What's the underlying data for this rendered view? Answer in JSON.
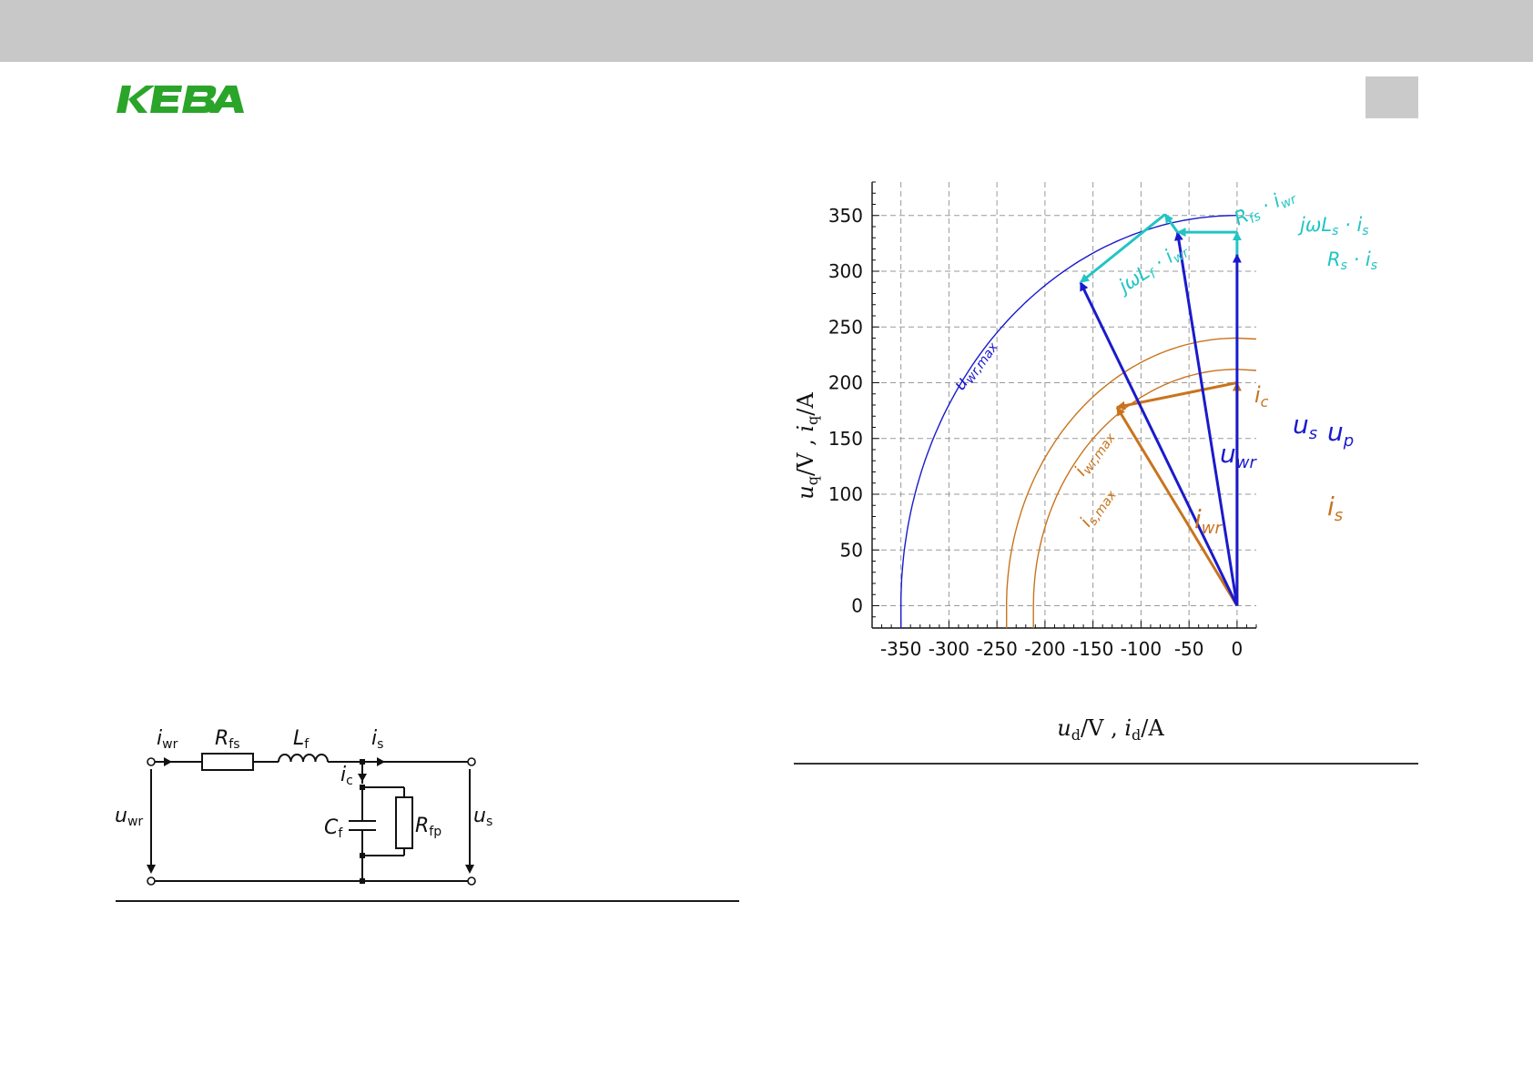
{
  "logo": {
    "text": "KEBA",
    "color": "#2aa52a"
  },
  "circuit": {
    "labels": {
      "i_wr": "i",
      "i_wr_sub": "wr",
      "R_fs": "R",
      "R_fs_sub": "fs",
      "L_f": "L",
      "L_f_sub": "f",
      "i_s": "i",
      "i_s_sub": "s",
      "i_c": "i",
      "i_c_sub": "c",
      "C_f": "C",
      "C_f_sub": "f",
      "R_fp": "R",
      "R_fp_sub": "fp",
      "u_wr": "u",
      "u_wr_sub": "wr",
      "u_s": "u",
      "u_s_sub": "s"
    }
  },
  "chart_data": {
    "type": "phasor-diagram",
    "xlabel": "ud/V , id/A",
    "ylabel": "uq/V , iq/A",
    "xlim": [
      -380,
      20
    ],
    "ylim": [
      -20,
      380
    ],
    "xticks": [
      -350,
      -300,
      -250,
      -200,
      -150,
      -100,
      -50,
      0
    ],
    "yticks": [
      0,
      50,
      100,
      150,
      200,
      250,
      300,
      350
    ],
    "grid": true,
    "colors": {
      "voltage": "#1a1acc",
      "current": "#c8741e",
      "drop": "#22c4c4"
    },
    "circles": [
      {
        "name": "uwr,max",
        "radius": 350,
        "color": "#1a1acc"
      },
      {
        "name": "iwr,max",
        "radius": 240,
        "color": "#c8741e"
      },
      {
        "name": "is,max",
        "radius": 212,
        "color": "#c8741e"
      }
    ],
    "vectors": [
      {
        "name": "is",
        "from": [
          0,
          0
        ],
        "to": [
          0,
          200
        ],
        "color": "#c8741e"
      },
      {
        "name": "iwr",
        "from": [
          0,
          0
        ],
        "to": [
          -125,
          178
        ],
        "color": "#c8741e"
      },
      {
        "name": "ic",
        "from": [
          0,
          200
        ],
        "to": [
          -125,
          178
        ],
        "color": "#c8741e"
      },
      {
        "name": "up",
        "from": [
          0,
          0
        ],
        "to": [
          0,
          315
        ],
        "color": "#1a1acc"
      },
      {
        "name": "us",
        "from": [
          0,
          0
        ],
        "to": [
          -62,
          335
        ],
        "color": "#1a1acc"
      },
      {
        "name": "uwr",
        "from": [
          0,
          0
        ],
        "to": [
          -163,
          290
        ],
        "color": "#1a1acc"
      },
      {
        "name": "Rs·is",
        "from": [
          0,
          315
        ],
        "to": [
          0,
          335
        ],
        "color": "#22c4c4"
      },
      {
        "name": "jωLs·is",
        "from": [
          0,
          335
        ],
        "to": [
          -62,
          335
        ],
        "color": "#22c4c4"
      },
      {
        "name": "Rfs·iwr",
        "from": [
          -62,
          335
        ],
        "to": [
          -75,
          351
        ],
        "color": "#22c4c4"
      },
      {
        "name": "jωLf·iwr",
        "from": [
          -75,
          351
        ],
        "to": [
          -163,
          290
        ],
        "color": "#22c4c4"
      }
    ],
    "annotations": [
      "uwr,max",
      "iwr,max",
      "is,max",
      "ic",
      "us",
      "up",
      "uwr",
      "is",
      "iwr",
      "Rs · is",
      "jωLs · is",
      "Rfs · iwr",
      "jωLf · iwr"
    ]
  }
}
